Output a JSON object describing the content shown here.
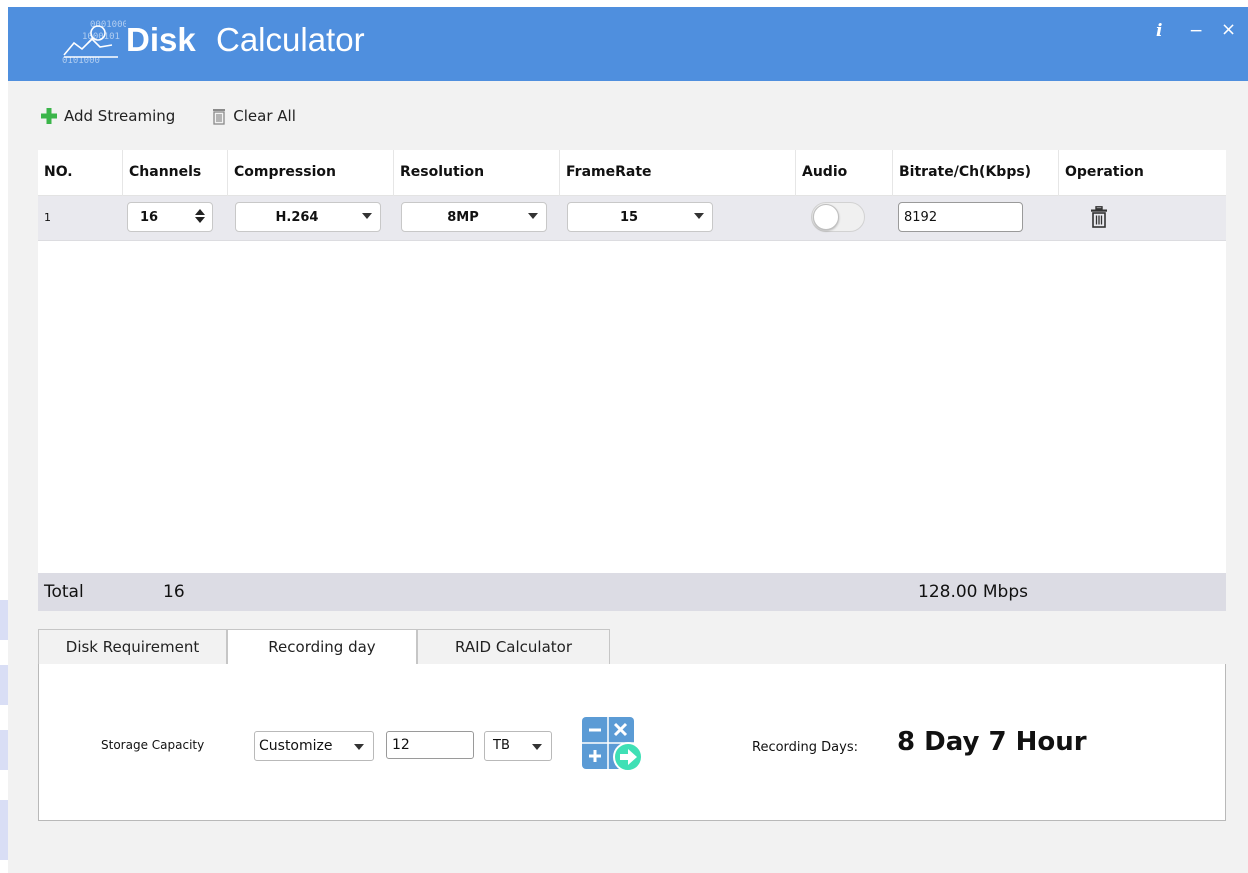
{
  "app": {
    "title_bold": "Disk",
    "title_rest": "Calculator",
    "info_label": "i",
    "minimize_label": "−",
    "close_label": "×"
  },
  "toolbar": {
    "add_label": "Add Streaming",
    "clear_label": "Clear All"
  },
  "table": {
    "headers": [
      "NO.",
      "Channels",
      "Compression",
      "Resolution",
      "FrameRate",
      "Audio",
      "Bitrate/Ch(Kbps)",
      "Operation"
    ],
    "rows": [
      {
        "no": "1",
        "channels": "16",
        "compression": "H.264",
        "resolution": "8MP",
        "framerate": "15",
        "audio_on": false,
        "bitrate": "8192"
      }
    ]
  },
  "totals": {
    "label": "Total",
    "channels": "16",
    "bandwidth": "128.00 Mbps"
  },
  "tabs": [
    "Disk Requirement",
    "Recording day",
    "RAID Calculator"
  ],
  "active_tab": "Recording day",
  "recording": {
    "storage_label": "Storage Capacity",
    "capacity_mode": "Customize",
    "capacity_value": "12",
    "capacity_unit": "TB",
    "result_label": "Recording Days:",
    "result_value": "8 Day 7 Hour"
  },
  "colors": {
    "titlebar": "#4f8fde",
    "add_icon": "#3bb54a",
    "calc_icon": "#5b9bd5",
    "calc_accent": "#3fe0b5"
  }
}
